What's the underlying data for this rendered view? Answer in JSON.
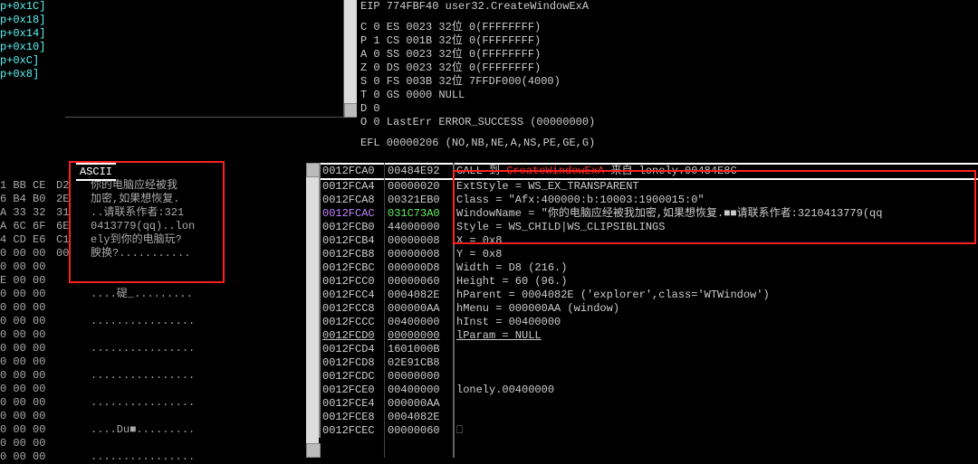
{
  "offsets": [
    "p+0x1C]",
    "p+0x18]",
    "p+0x14]",
    "p+0x10]",
    "p+0xC]",
    "p+0x8]"
  ],
  "reg": {
    "eip": "EIP 774FBF40 user32.CreateWindowExA",
    "flags": [
      "C 0   ES 0023 32位 0(FFFFFFFF)",
      "P 1   CS 001B 32位 0(FFFFFFFF)",
      "A 0   SS 0023 32位 0(FFFFFFFF)",
      "Z 0   DS 0023 32位 0(FFFFFFFF)",
      "S 0   FS 003B 32位 7FFDF000(4000)",
      "T 0   GS 0000 NULL",
      "D 0",
      "O 0   LastErr ERROR_SUCCESS (00000000)"
    ],
    "efl": "EFL 00000206 (NO,NB,NE,A,NS,PE,GE,G)"
  },
  "ascii_header": "ASCII",
  "hex_rows": [
    {
      "b": "1 BB CE",
      "c": "D2",
      "a": "你的电脑应经被我"
    },
    {
      "b": "6 B4 B0",
      "c": "2E",
      "a": "加密,如果想恢复."
    },
    {
      "b": "A 33 32",
      "c": "31",
      "a": "..请联系作者:321"
    },
    {
      "b": "A 6C 6F",
      "c": "6E",
      "a": "0413779(qq)..lon"
    },
    {
      "b": "4 CD E6",
      "c": "C1",
      "a": "ely到你的电脑玩?"
    },
    {
      "b": "0 00 00",
      "c": "00",
      "a": "腴换?..........."
    },
    {
      "b": "0 00 00",
      "c": "",
      "a": ""
    },
    {
      "b": "E 00 00",
      "c": "",
      "a": ""
    },
    {
      "b": "0 00 00",
      "c": "",
      "a": "....碮_........."
    },
    {
      "b": "0 00 00",
      "c": "",
      "a": ""
    },
    {
      "b": "0 00 00",
      "c": "",
      "a": "................"
    },
    {
      "b": "0 00 00",
      "c": "",
      "a": ""
    },
    {
      "b": "0 00 00",
      "c": "",
      "a": "................"
    },
    {
      "b": "0 00 00",
      "c": "",
      "a": ""
    },
    {
      "b": "0 00 00",
      "c": "",
      "a": "................"
    },
    {
      "b": "0 00 00",
      "c": "",
      "a": ""
    },
    {
      "b": "0 00 00",
      "c": "",
      "a": "................"
    },
    {
      "b": "0 00 00",
      "c": "",
      "a": ""
    },
    {
      "b": "0 00 00",
      "c": "",
      "a": "....Du■........."
    },
    {
      "b": "0 00 00",
      "c": "",
      "a": ""
    },
    {
      "b": "0 00 00",
      "c": "",
      "a": "................"
    }
  ],
  "stack": [
    {
      "addr": "0012FCA0",
      "val": "00484E92",
      "desc_pre": "CALL 到 ",
      "desc_red": "CreateWindowExA",
      "desc_post": " 来自 lonely.00484E8C",
      "hdr": true
    },
    {
      "addr": "0012FCA4",
      "val": "00000020",
      "desc": "ExtStyle = WS_EX_TRANSPARENT"
    },
    {
      "addr": "0012FCA8",
      "val": "00321EB0",
      "desc": "Class = \"Afx:400000:b:10003:1900015:0\""
    },
    {
      "addr": "0012FCAC",
      "val": "031C73A0",
      "desc": "WindowName = \"你的电脑应经被我加密,如果想恢复.■■请联系作者:3210413779(qq",
      "hl": true
    },
    {
      "addr": "0012FCB0",
      "val": "44000000",
      "desc": "Style = WS_CHILD|WS_CLIPSIBLINGS"
    },
    {
      "addr": "0012FCB4",
      "val": "00000008",
      "desc": "X = 0x8"
    },
    {
      "addr": "0012FCB8",
      "val": "00000008",
      "desc": "Y = 0x8"
    },
    {
      "addr": "0012FCBC",
      "val": "000000D8",
      "desc": "Width = D8 (216.)"
    },
    {
      "addr": "0012FCC0",
      "val": "00000060",
      "desc": "Height = 60 (96.)"
    },
    {
      "addr": "0012FCC4",
      "val": "0004082E",
      "desc": "hParent = 0004082E ('explorer',class='WTWindow')"
    },
    {
      "addr": "0012FCC8",
      "val": "000000AA",
      "desc": "hMenu = 000000AA (window)"
    },
    {
      "addr": "0012FCCC",
      "val": "00400000",
      "desc": "hInst = 00400000"
    },
    {
      "addr": "0012FCD0",
      "val": "00000000",
      "desc": "lParam = NULL",
      "last": true
    },
    {
      "addr": "0012FCD4",
      "val": "1601000B",
      "desc": ""
    },
    {
      "addr": "0012FCD8",
      "val": "02E91CB8",
      "desc": ""
    },
    {
      "addr": "0012FCDC",
      "val": "00000000",
      "desc": ""
    },
    {
      "addr": "0012FCE0",
      "val": "00400000",
      "desc": "lonely.00400000"
    },
    {
      "addr": "0012FCE4",
      "val": "000000AA",
      "desc": ""
    },
    {
      "addr": "0012FCE8",
      "val": "0004082E",
      "desc": ""
    },
    {
      "addr": "0012FCEC",
      "val": "00000060",
      "desc": "",
      "cursor": true
    }
  ]
}
